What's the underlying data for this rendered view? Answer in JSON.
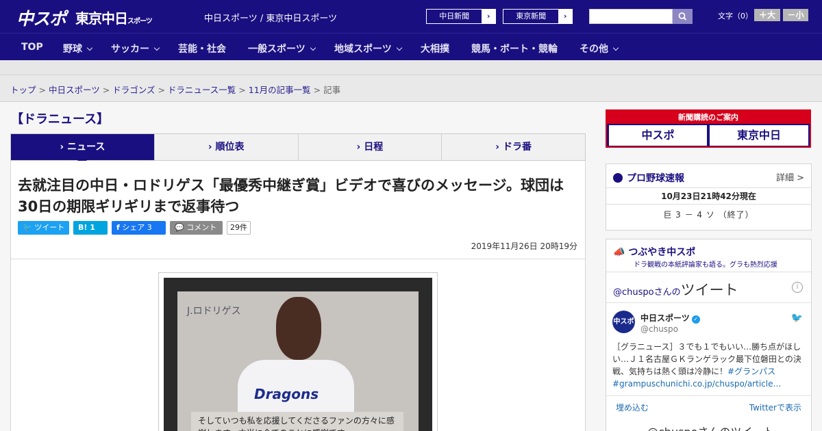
{
  "header": {
    "logo_main": "中スポ",
    "logo_tokyo": "東京中日",
    "logo_tokyo_small": "スポーツ",
    "site_name": "中日スポーツ / 東京中日スポーツ",
    "paper_links": [
      {
        "label": "中日新聞",
        "arrow": "›"
      },
      {
        "label": "東京新聞",
        "arrow": "›"
      }
    ],
    "search_placeholder": "",
    "font_size_label": "文字（0）",
    "font_bigger": "＋大",
    "font_smaller": "－小"
  },
  "nav": {
    "items": [
      {
        "label": "TOP",
        "has_menu": false
      },
      {
        "label": "野球",
        "has_menu": true
      },
      {
        "label": "サッカー",
        "has_menu": true
      },
      {
        "label": "芸能・社会",
        "has_menu": false
      },
      {
        "label": "一般スポーツ",
        "has_menu": true
      },
      {
        "label": "地域スポーツ",
        "has_menu": true
      },
      {
        "label": "大相撲",
        "has_menu": false
      },
      {
        "label": "競馬・ボート・競輪",
        "has_menu": false
      },
      {
        "label": "その他",
        "has_menu": true
      }
    ]
  },
  "breadcrumb": {
    "items": [
      "トップ",
      "中日スポーツ",
      "ドラゴンズ",
      "ドラニュース一覧",
      "11月の記事一覧"
    ],
    "current": "記事",
    "separator": ">"
  },
  "section_title": "【ドラニュース】",
  "tabs": [
    {
      "label": "ニュース",
      "active": true
    },
    {
      "label": "順位表",
      "active": false
    },
    {
      "label": "日程",
      "active": false
    },
    {
      "label": "ドラ番",
      "active": false
    }
  ],
  "article": {
    "headline": "去就注目の中日・ロドリゲス「最優秀中継ぎ賞」ビデオで喜びのメッセージ。球団は30日の期限ギリギリまで返事待つ",
    "share": {
      "tweet": "ツイート",
      "hatena": "B! 1",
      "facebook": "シェア 3",
      "comment": "コメント",
      "comment_count": "29件"
    },
    "date": "2019年11月26日 20時19分",
    "photo": {
      "name_plate": "J.ロドリゲス",
      "jersey_text": "Dragons",
      "caption": "そしていつも私を応援してくださるファンの方々に感謝します。本当に全てのことに感謝です。"
    }
  },
  "sidebar": {
    "subscribe": {
      "head": "新聞購読のご案内",
      "left": "中スポ",
      "right": "東京中日"
    },
    "baseball": {
      "title": "プロ野球速報",
      "detail": "詳細 >",
      "time": "10月23日21時42分現在",
      "score": "巨 3 － 4 ソ （終了）"
    },
    "tweets": {
      "title": "つぶやき中スポ",
      "subtitle": "ドラ観戦の本紙評論家も語る。グラも熱烈応援",
      "by_prefix": "@chuspoさんの",
      "by_main": "ツイート",
      "account_name": "中日スポーツ",
      "account_handle": "@chuspo",
      "avatar_text": "中スポ",
      "text": "［グラニュース］３でも１でもいい…勝ち点がほしい…Ｊ１名古屋ＧＫランゲラック最下位磐田との決戦、気持ちは熱く頭は冷静に！",
      "tag1": "#グランパス",
      "tag2": "#grampus",
      "link": "chunichi.co.jp/chuspo/article…",
      "embed": "埋め込む",
      "view_on_twitter": "Twitterで表示",
      "more": "@chuspoさんのツイート"
    }
  },
  "colors": {
    "brand_navy": "#1a0f80",
    "accent_red": "#d6001c",
    "twitter_blue": "#1da1f2",
    "hatena_blue": "#00a4de",
    "facebook_blue": "#1877f2"
  }
}
